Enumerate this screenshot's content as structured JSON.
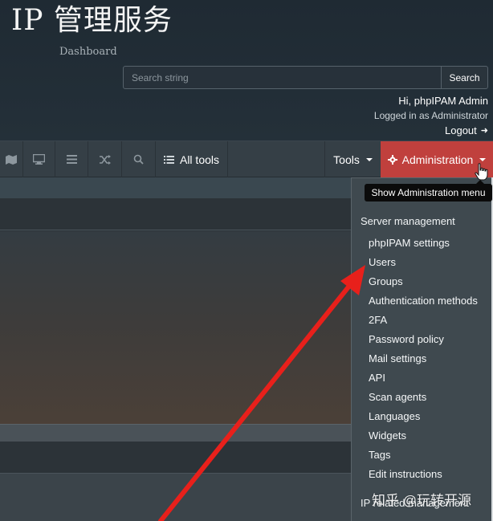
{
  "header": {
    "app_title": "IP 管理服务",
    "subtitle": "Dashboard",
    "search": {
      "placeholder": "Search string",
      "value": ""
    },
    "search_button": "Search",
    "greeting": "Hi, phpIPAM Admin",
    "logged_in_as": "Logged in as  Administrator",
    "logout": "Logout"
  },
  "navbar": {
    "icon_buttons": [
      "map-icon",
      "monitor-icon",
      "list-icon",
      "shuffle-icon",
      "search-icon"
    ],
    "all_tools": "All tools",
    "tools": "Tools",
    "administration": "Administration",
    "accent_color": "#c0403d"
  },
  "tooltip": "Show Administration menu",
  "dropdown": {
    "header": "Server management",
    "items": [
      "phpIPAM settings",
      "Users",
      "Groups",
      "Authentication methods",
      "2FA",
      "Password policy",
      "Mail settings",
      "API",
      "Scan agents",
      "Languages",
      "Widgets",
      "Tags",
      "Edit instructions"
    ],
    "footer_header": "IP related management"
  },
  "annotation": {
    "arrow_color": "#e8201b"
  },
  "watermark": "知乎 @玩转开源"
}
